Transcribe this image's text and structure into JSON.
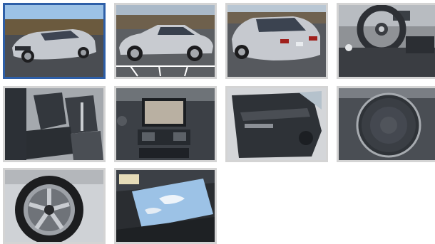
{
  "gallery": {
    "selected_index": 0,
    "colors": {
      "selected_border": "#2e5fa8",
      "border": "#d4d4d4",
      "car_silver": "#c4c8ce",
      "interior_dark": "#2c3036",
      "sky": "#9cc2e6"
    },
    "thumbnails": [
      {
        "subject": "car-front-three-quarter-photo"
      },
      {
        "subject": "car-side-profile-photo"
      },
      {
        "subject": "car-rear-three-quarter-photo"
      },
      {
        "subject": "steering-wheel-dashboard-photo"
      },
      {
        "subject": "front-seats-photo"
      },
      {
        "subject": "center-console-navigation-photo"
      },
      {
        "subject": "door-panel-photo"
      },
      {
        "subject": "speaker-grille-photo"
      },
      {
        "subject": "wheel-rim-photo"
      },
      {
        "subject": "sunroof-photo"
      }
    ]
  }
}
